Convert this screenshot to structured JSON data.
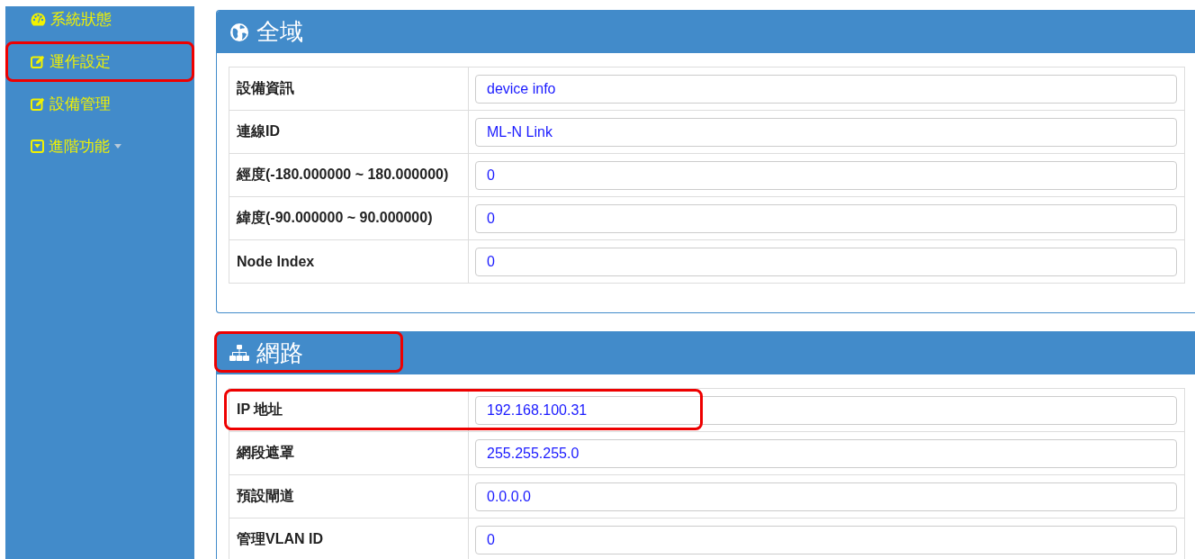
{
  "sidebar": {
    "items": [
      {
        "label": "系統狀態",
        "kind": "dashboard",
        "highlighted": false
      },
      {
        "label": "運作設定",
        "kind": "edit",
        "highlighted": true
      },
      {
        "label": "設備管理",
        "kind": "edit",
        "highlighted": false
      },
      {
        "label": "進階功能",
        "kind": "dropdown",
        "highlighted": false
      }
    ]
  },
  "sections": [
    {
      "title": "全域",
      "kind": "globe",
      "highlighted": false,
      "rows": [
        {
          "label": "設備資訊",
          "value": "device info",
          "highlighted": false
        },
        {
          "label": "連線ID",
          "value": "ML-N Link",
          "highlighted": false
        },
        {
          "label": "經度(-180.000000 ~ 180.000000)",
          "value": "0",
          "highlighted": false
        },
        {
          "label": "緯度(-90.000000 ~ 90.000000)",
          "value": "0",
          "highlighted": false
        },
        {
          "label": "Node Index",
          "value": "0",
          "highlighted": false
        }
      ]
    },
    {
      "title": "網路",
      "kind": "network",
      "highlighted": true,
      "rows": [
        {
          "label": "IP 地址",
          "value": "192.168.100.31",
          "highlighted": true
        },
        {
          "label": "網段遮罩",
          "value": "255.255.255.0",
          "highlighted": false
        },
        {
          "label": "預設閘道",
          "value": "0.0.0.0",
          "highlighted": false
        },
        {
          "label": "管理VLAN ID",
          "value": "0",
          "highlighted": false
        }
      ]
    }
  ]
}
